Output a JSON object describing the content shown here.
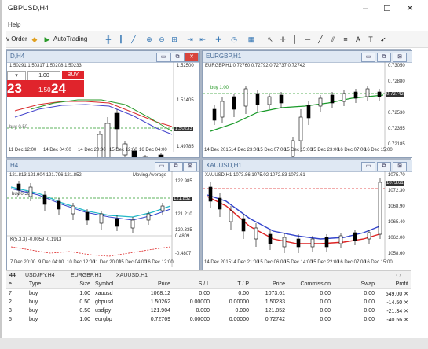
{
  "window": {
    "title": "GBPUSD,H4",
    "minimize": "–",
    "maximize": "☐",
    "close": "✕"
  },
  "menu": {
    "help": "Help"
  },
  "toolbar": {
    "order": "v Order",
    "autotrading": "AutoTrading"
  },
  "charts": [
    {
      "title": "D,H4",
      "info": "1.50291 1.50317 1.50208 1.50233",
      "lot": "1.00",
      "buy": "BUY",
      "price_sell": "23",
      "price_buy_small": "1.50",
      "price_buy": "24",
      "order_line": "buy 0.50",
      "prices": [
        "1.52500",
        "1.51405",
        "1.50233",
        "1.49785"
      ],
      "dates": [
        "11 Dec 12:00",
        "14 Dec 04:00",
        "14 Dec 20:00",
        "15 Dec 12:00",
        "16 Dec 04:00"
      ]
    },
    {
      "title": "EURGBP,H1",
      "info": "EURGBP,H1  0.72760 0.72792 0.72737 0.72742",
      "order_line": "buy 1.00",
      "prices": [
        "0.73050",
        "0.72880",
        "0.72742",
        "0.72530",
        "0.72355",
        "0.72185"
      ],
      "dates": [
        "14 Dec 2015",
        "14 Dec 23:00",
        "15 Dec 07:00",
        "15 Dec 15:00",
        "15 Dec 23:00",
        "16 Dec 07:00",
        "16 Dec 15:00"
      ]
    },
    {
      "title": "H4",
      "info": "121.813 121.904 121.796 121.852",
      "indicator": "Moving Average",
      "order_line": "buy 0.50",
      "prices": [
        "122.985",
        "121.852",
        "121.210",
        "120.335"
      ],
      "osc_label": "K(5,3,3) -0.0059 -0.1913",
      "osc_values": [
        "0.4809",
        "-0.4807"
      ],
      "dates": [
        "7 Dec 20:00",
        "9 Dec 04:00",
        "10 Dec 12:00",
        "11 Dec 20:00",
        "15 Dec 04:00",
        "16 Dec 12:00"
      ]
    },
    {
      "title": "XAUUSD,H1",
      "info": "XAUUSD,H1  1073.86 1075.02 1072.83 1073.61",
      "prices": [
        "1075.70",
        "1073.61",
        "1072.30",
        "1068.90",
        "1065.40",
        "1062.00",
        "1058.60"
      ],
      "dates": [
        "14 Dec 2015",
        "14 Dec 21:00",
        "15 Dec 06:00",
        "15 Dec 14:00",
        "15 Dec 22:00",
        "16 Dec 07:00",
        "16 Dec 15:00"
      ]
    }
  ],
  "tabs": [
    "44",
    "USDJPY,H4",
    "EURGBP,H1",
    "XAUUSD,H1"
  ],
  "terminal": {
    "columns": [
      "e",
      "Type",
      "Size",
      "Symbol",
      "Price",
      "S / L",
      "T / P",
      "Price",
      "Commission",
      "Swap",
      "Profit"
    ],
    "rows": [
      [
        "7",
        "buy",
        "1.00",
        "xauusd",
        "1068.12",
        "0.00",
        "0.00",
        "1073.61",
        "0.00",
        "0.00",
        "549.00"
      ],
      [
        "2",
        "buy",
        "0.50",
        "gbpusd",
        "1.50262",
        "0.00000",
        "0.00000",
        "1.50233",
        "0.00",
        "0.00",
        "-14.50"
      ],
      [
        "3",
        "buy",
        "0.50",
        "usdjpy",
        "121.904",
        "0.000",
        "0.000",
        "121.852",
        "0.00",
        "0.00",
        "-21.34"
      ],
      [
        "5",
        "buy",
        "1.00",
        "eurgbp",
        "0.72769",
        "0.00000",
        "0.00000",
        "0.72742",
        "0.00",
        "0.00",
        "-40.56"
      ]
    ]
  },
  "colors": {
    "up_candle": "#ffffff",
    "down_candle": "#000000",
    "ma_green": "#1a9a2a",
    "ma_blue": "#3344cc",
    "ma_red": "#dd2222",
    "ma_cyan": "#22b8c8",
    "buy_red": "#e0242c"
  }
}
